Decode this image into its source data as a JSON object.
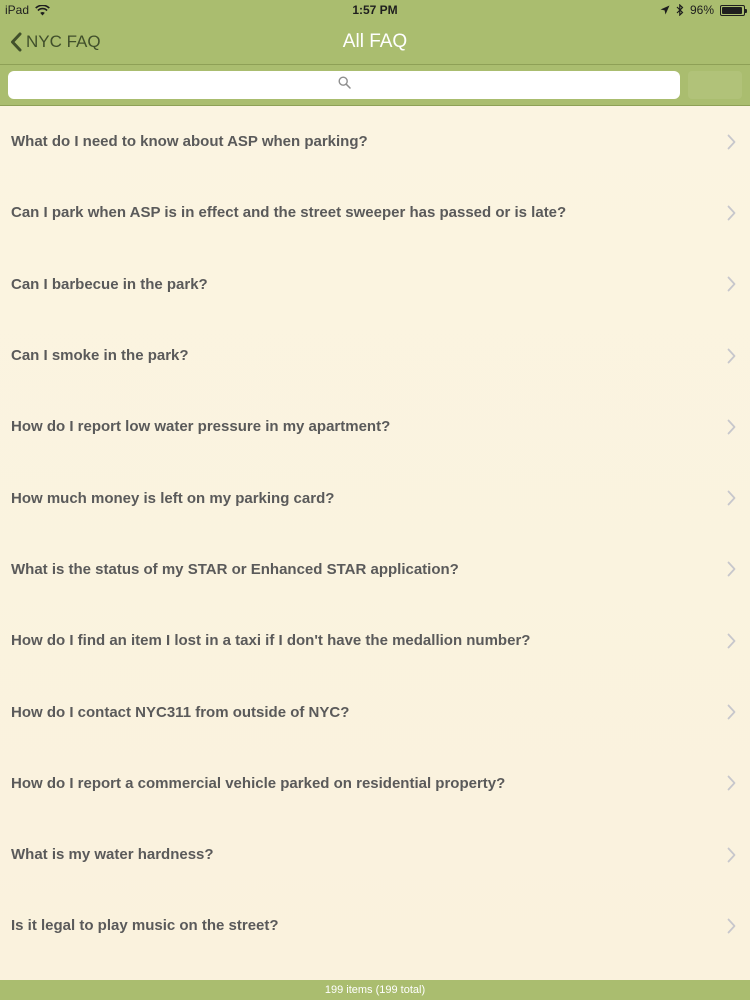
{
  "status_bar": {
    "device": "iPad",
    "time": "1:57 PM",
    "battery": "96%"
  },
  "nav": {
    "back_label": "NYC FAQ",
    "title": "All FAQ"
  },
  "search": {
    "placeholder": "",
    "value": ""
  },
  "faq": {
    "items": [
      "What do I need to know about ASP when parking?",
      "Can I park when ASP is in effect and the street sweeper has passed or is late?",
      "Can I barbecue in the park?",
      "Can I smoke in the park?",
      "How do I report low water pressure in my apartment?",
      "How much money is left on my parking card?",
      "What is the status of my STAR or Enhanced STAR application?",
      "How do I find an item I lost in a taxi if I don't have the medallion number?",
      "How do I contact NYC311 from outside of NYC?",
      "How do I report a commercial vehicle parked on residential property?",
      "What is my water hardness?",
      "Is it legal to play music on the street?"
    ]
  },
  "footer": {
    "count_text": "199 items (199 total)"
  },
  "colors": {
    "bar": "#aabd6f",
    "list_bg": "#faf2de",
    "row_text": "#5a5a5a",
    "title_text": "#ffffff",
    "back_text": "#41502b"
  },
  "icons": {
    "wifi": "wifi-icon",
    "location": "location-icon",
    "bluetooth": "bluetooth-icon",
    "battery": "battery-icon",
    "back": "chevron-left-icon",
    "search": "search-icon",
    "row": "chevron-right-icon"
  }
}
